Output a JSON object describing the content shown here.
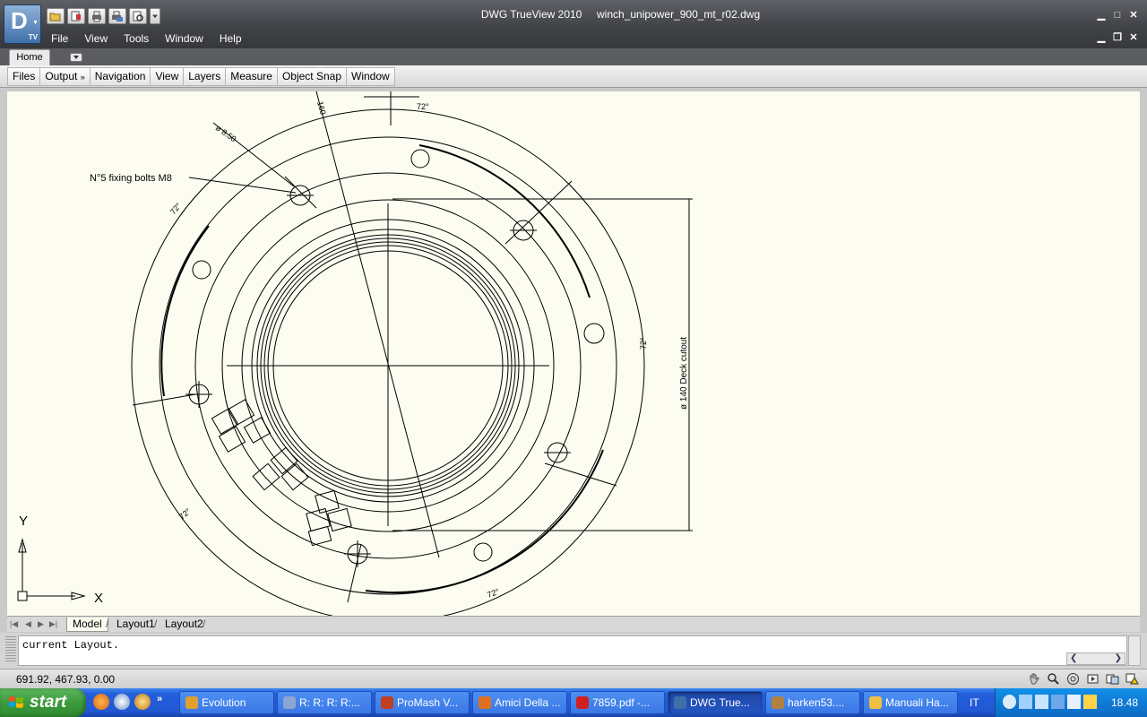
{
  "window": {
    "app_name": "DWG TrueView 2010",
    "file_name": "winch_unipower_900_mt_r02.dwg",
    "logo_letter": "D",
    "logo_sub": "TV"
  },
  "menu": [
    "File",
    "View",
    "Tools",
    "Window",
    "Help"
  ],
  "ribbon": {
    "tab": "Home",
    "panels": [
      "Files",
      "Output",
      "Navigation",
      "View",
      "Layers",
      "Measure",
      "Object Snap",
      "Window"
    ],
    "output_more": "»"
  },
  "drawing": {
    "annotations": {
      "bolts": "N°5 fixing bolts M8",
      "dia_bolt": "ø 8.50",
      "cutout": "ø 140  Deck cutout",
      "angle": "72°",
      "dim_160": "160"
    }
  },
  "ucs": {
    "x": "X",
    "y": "Y"
  },
  "layout_tabs": [
    "Model",
    "Layout1",
    "Layout2"
  ],
  "command_line": {
    "text": "current Layout."
  },
  "status": {
    "coords": "691.92, 467.93, 0.00"
  },
  "taskbar": {
    "start": "start",
    "quick_more": "»",
    "buttons": [
      {
        "label": "Evolution",
        "color": "#e0a030"
      },
      {
        "label": "R: R: R: R:...",
        "color": "#8aa6d0"
      },
      {
        "label": "ProMash V...",
        "color": "#c04020"
      },
      {
        "label": "Amici Della ...",
        "color": "#e07020"
      },
      {
        "label": "7859.pdf -...",
        "color": "#d02020"
      },
      {
        "label": "DWG True...",
        "color": "#3f6fa8"
      },
      {
        "label": "harken53....",
        "color": "#b08040"
      },
      {
        "label": "Manuali Ha...",
        "color": "#f0c040"
      }
    ],
    "lang": "IT",
    "clock": "18.48"
  }
}
